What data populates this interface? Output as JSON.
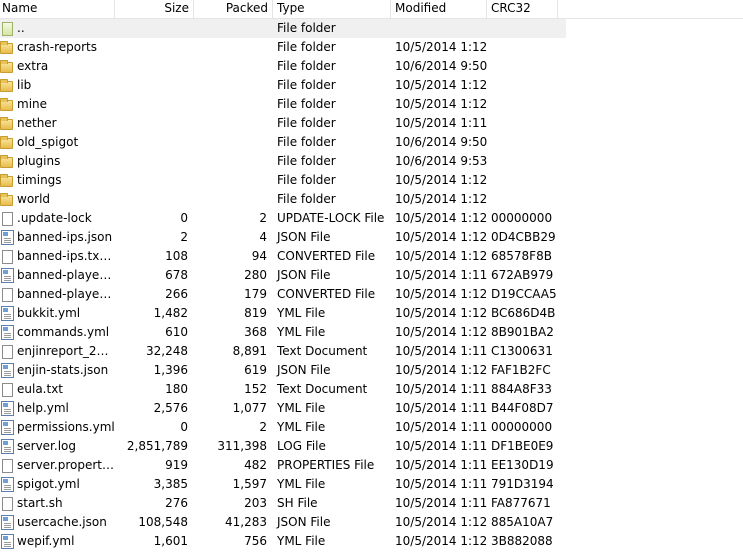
{
  "columns": {
    "name": "Name",
    "size": "Size",
    "packed": "Packed",
    "type": "Type",
    "modified": "Modified",
    "crc": "CRC32"
  },
  "files": [
    {
      "name": "..",
      "size": "",
      "packed": "",
      "type": "File folder",
      "modified": "",
      "crc": "",
      "icon": "parent-folder-icon"
    },
    {
      "name": "crash-reports",
      "size": "",
      "packed": "",
      "type": "File folder",
      "modified": "10/5/2014 1:12 ...",
      "crc": "",
      "icon": "folder-icon"
    },
    {
      "name": "extra",
      "size": "",
      "packed": "",
      "type": "File folder",
      "modified": "10/6/2014 9:50 ...",
      "crc": "",
      "icon": "folder-icon"
    },
    {
      "name": "lib",
      "size": "",
      "packed": "",
      "type": "File folder",
      "modified": "10/5/2014 1:12 ...",
      "crc": "",
      "icon": "folder-icon"
    },
    {
      "name": "mine",
      "size": "",
      "packed": "",
      "type": "File folder",
      "modified": "10/5/2014 1:12 ...",
      "crc": "",
      "icon": "folder-icon"
    },
    {
      "name": "nether",
      "size": "",
      "packed": "",
      "type": "File folder",
      "modified": "10/5/2014 1:11 ...",
      "crc": "",
      "icon": "folder-icon"
    },
    {
      "name": "old_spigot",
      "size": "",
      "packed": "",
      "type": "File folder",
      "modified": "10/6/2014 9:50 ...",
      "crc": "",
      "icon": "folder-icon"
    },
    {
      "name": "plugins",
      "size": "",
      "packed": "",
      "type": "File folder",
      "modified": "10/6/2014 9:53 ...",
      "crc": "",
      "icon": "folder-icon"
    },
    {
      "name": "timings",
      "size": "",
      "packed": "",
      "type": "File folder",
      "modified": "10/5/2014 1:12 ...",
      "crc": "",
      "icon": "folder-icon"
    },
    {
      "name": "world",
      "size": "",
      "packed": "",
      "type": "File folder",
      "modified": "10/5/2014 1:12 ...",
      "crc": "",
      "icon": "folder-icon"
    },
    {
      "name": ".update-lock",
      "size": "0",
      "packed": "2",
      "type": "UPDATE-LOCK File",
      "modified": "10/5/2014 1:12 ...",
      "crc": "00000000",
      "icon": "file-icon"
    },
    {
      "name": "banned-ips.json",
      "size": "2",
      "packed": "4",
      "type": "JSON File",
      "modified": "10/5/2014 1:12 ...",
      "crc": "0D4CBB29",
      "icon": "document-icon"
    },
    {
      "name": "banned-ips.txt.c...",
      "size": "108",
      "packed": "94",
      "type": "CONVERTED File",
      "modified": "10/5/2014 1:12 ...",
      "crc": "68578F8B",
      "icon": "file-icon"
    },
    {
      "name": "banned-players....",
      "size": "678",
      "packed": "280",
      "type": "JSON File",
      "modified": "10/5/2014 1:11 ...",
      "crc": "672AB979",
      "icon": "document-icon"
    },
    {
      "name": "banned-players....",
      "size": "266",
      "packed": "179",
      "type": "CONVERTED File",
      "modified": "10/5/2014 1:12 ...",
      "crc": "D19CCAA5",
      "icon": "file-icon"
    },
    {
      "name": "bukkit.yml",
      "size": "1,482",
      "packed": "819",
      "type": "YML File",
      "modified": "10/5/2014 1:12 ...",
      "crc": "BC686D4B",
      "icon": "document-icon"
    },
    {
      "name": "commands.yml",
      "size": "610",
      "packed": "368",
      "type": "YML File",
      "modified": "10/5/2014 1:12 ...",
      "crc": "8B901BA2",
      "icon": "document-icon"
    },
    {
      "name": "enjinreport_2014...",
      "size": "32,248",
      "packed": "8,891",
      "type": "Text Document",
      "modified": "10/5/2014 1:11 ...",
      "crc": "C1300631",
      "icon": "file-icon"
    },
    {
      "name": "enjin-stats.json",
      "size": "1,396",
      "packed": "619",
      "type": "JSON File",
      "modified": "10/5/2014 1:12 ...",
      "crc": "FAF1B2FC",
      "icon": "document-icon"
    },
    {
      "name": "eula.txt",
      "size": "180",
      "packed": "152",
      "type": "Text Document",
      "modified": "10/5/2014 1:11 ...",
      "crc": "884A8F33",
      "icon": "file-icon"
    },
    {
      "name": "help.yml",
      "size": "2,576",
      "packed": "1,077",
      "type": "YML File",
      "modified": "10/5/2014 1:11 ...",
      "crc": "B44F08D7",
      "icon": "document-icon"
    },
    {
      "name": "permissions.yml",
      "size": "0",
      "packed": "2",
      "type": "YML File",
      "modified": "10/5/2014 1:11 ...",
      "crc": "00000000",
      "icon": "document-icon"
    },
    {
      "name": "server.log",
      "size": "2,851,789",
      "packed": "311,398",
      "type": "LOG File",
      "modified": "10/5/2014 1:11 ...",
      "crc": "DF1BE0E9",
      "icon": "document-icon"
    },
    {
      "name": "server.properties",
      "size": "919",
      "packed": "482",
      "type": "PROPERTIES File",
      "modified": "10/5/2014 1:11 ...",
      "crc": "EE130D19",
      "icon": "file-icon"
    },
    {
      "name": "spigot.yml",
      "size": "3,385",
      "packed": "1,597",
      "type": "YML File",
      "modified": "10/5/2014 1:11 ...",
      "crc": "791D3194",
      "icon": "document-icon"
    },
    {
      "name": "start.sh",
      "size": "276",
      "packed": "203",
      "type": "SH File",
      "modified": "10/5/2014 1:11 ...",
      "crc": "FA877671",
      "icon": "file-icon"
    },
    {
      "name": "usercache.json",
      "size": "108,548",
      "packed": "41,283",
      "type": "JSON File",
      "modified": "10/5/2014 1:12 ...",
      "crc": "885A10A7",
      "icon": "document-icon"
    },
    {
      "name": "wepif.yml",
      "size": "1,601",
      "packed": "756",
      "type": "YML File",
      "modified": "10/5/2014 1:12 ...",
      "crc": "3B882088",
      "icon": "document-icon"
    }
  ]
}
